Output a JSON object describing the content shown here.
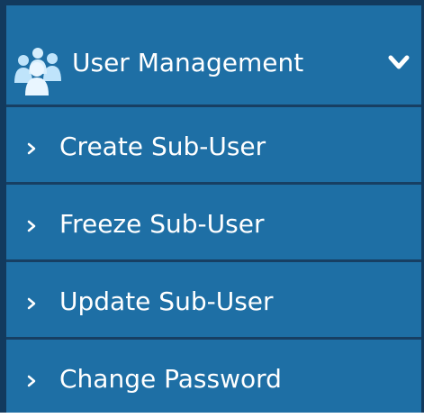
{
  "menu": {
    "header": {
      "label": "User Management",
      "icon": "users-icon",
      "toggle_icon": "chevron-down-icon"
    },
    "items": [
      {
        "label": "Create Sub-User",
        "icon": "chevron-right-icon"
      },
      {
        "label": "Freeze Sub-User",
        "icon": "chevron-right-icon"
      },
      {
        "label": "Update Sub-User",
        "icon": "chevron-right-icon"
      },
      {
        "label": "Change Password",
        "icon": "chevron-right-icon"
      }
    ],
    "colors": {
      "background": "#1e6fa5",
      "border": "#123a5e",
      "divider": "#173f63",
      "text": "#ffffff",
      "icon_light": "#bfe4fb"
    }
  }
}
